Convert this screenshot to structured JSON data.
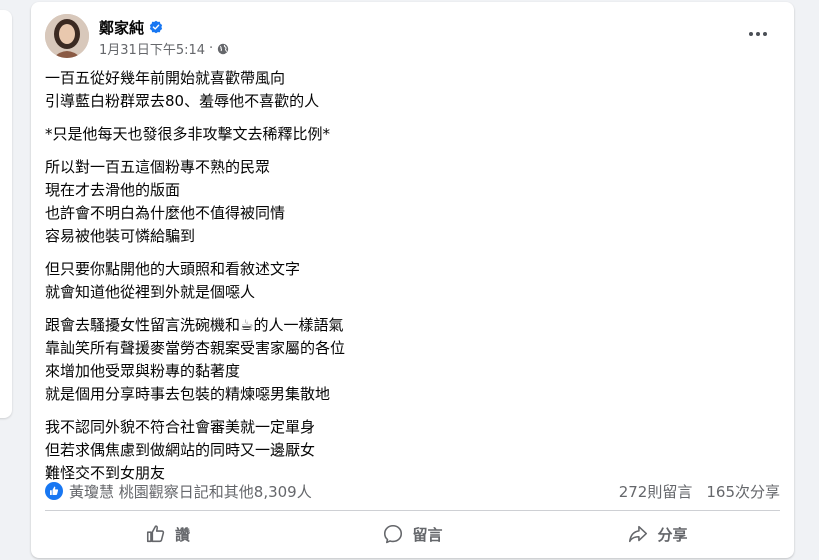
{
  "post": {
    "author": "鄭家純",
    "timestamp": "1月31日下午5:14",
    "meta_separator": "·",
    "paragraphs": [
      [
        "一百五從好幾年前開始就喜歡帶風向",
        "引導藍白粉群眾去80、羞辱他不喜歡的人"
      ],
      [
        "*只是他每天也發很多非攻擊文去稀釋比例*"
      ],
      [
        "所以對一百五這個粉專不熟的民眾",
        "現在才去滑他的版面",
        "也許會不明白為什麼他不值得被同情",
        "容易被他裝可憐給騙到"
      ],
      [
        "但只要你點開他的大頭照和看敘述文字",
        "就會知道他從裡到外就是個噁人"
      ],
      [
        "跟會去騷擾女性留言洗碗機和☕的人一樣語氣",
        "靠訕笑所有聲援麥當勞杏親案受害家屬的各位",
        "來增加他受眾與粉專的黏著度",
        "就是個用分享時事去包裝的精煉噁男集散地"
      ],
      [
        "我不認同外貌不符合社會審美就一定單身",
        "但若求偶焦慮到做網站的同時又一邊厭女",
        "難怪交不到女朋友"
      ]
    ]
  },
  "reactions": {
    "summary": "黃瓊慧 桃園觀察日記和其他8,309人",
    "comments": "272則留言",
    "shares": "165次分享"
  },
  "actions": {
    "like": "讚",
    "comment": "留言",
    "share": "分享"
  },
  "colors": {
    "facebook_blue": "#1877f2",
    "secondary_text": "#65676b",
    "background": "#f0f2f5"
  },
  "icons": {
    "verified": "verified-badge-icon",
    "audience": "globe-icon",
    "more": "more-options-icon",
    "reaction": "like-reaction-icon",
    "like": "thumbs-up-icon",
    "comment": "comment-bubble-icon",
    "share": "share-arrow-icon"
  }
}
